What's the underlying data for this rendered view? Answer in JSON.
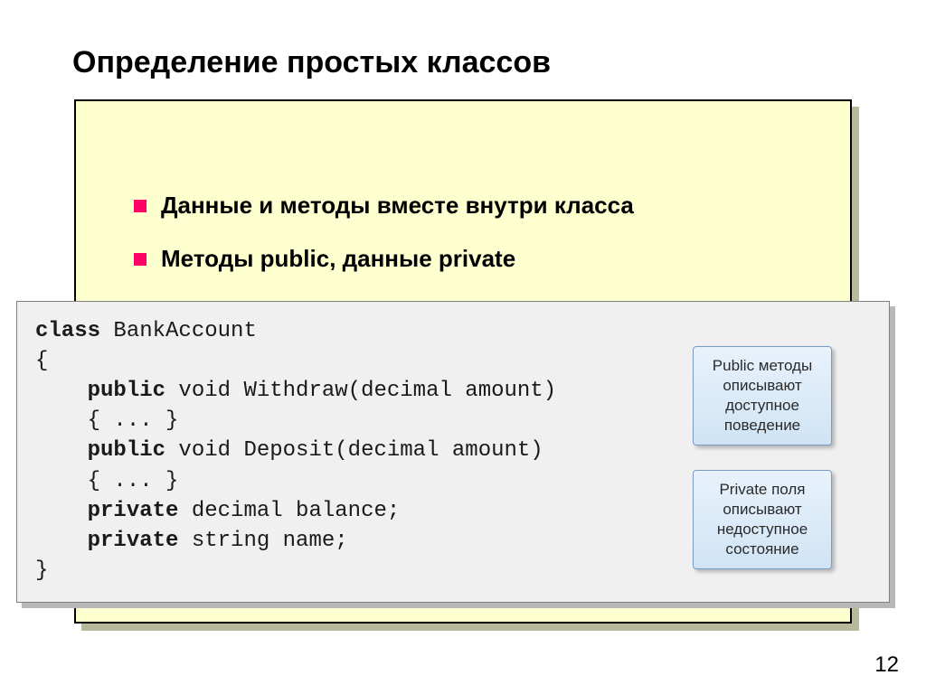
{
  "title": "Определение простых классов",
  "bullets": [
    "Данные и методы вместе внутри класса",
    "Методы public, данные private"
  ],
  "code": {
    "l1a": "class",
    "l1b": " BankAccount",
    "l2": "{",
    "l3a": "    ",
    "l3b": "public",
    "l3c": " void Withdraw(decimal amount)",
    "l4": "    { ... }",
    "l5a": "    ",
    "l5b": "public",
    "l5c": " void Deposit(decimal amount)",
    "l6": "    { ... }",
    "l7a": "    ",
    "l7b": "private",
    "l7c": " decimal balance;",
    "l8a": "    ",
    "l8b": "private",
    "l8c": " string name;",
    "l9": "}"
  },
  "callouts": {
    "public": "Public методы описывают доступное поведение",
    "private": "Private поля описывают недоступное состояние"
  },
  "page": "12"
}
